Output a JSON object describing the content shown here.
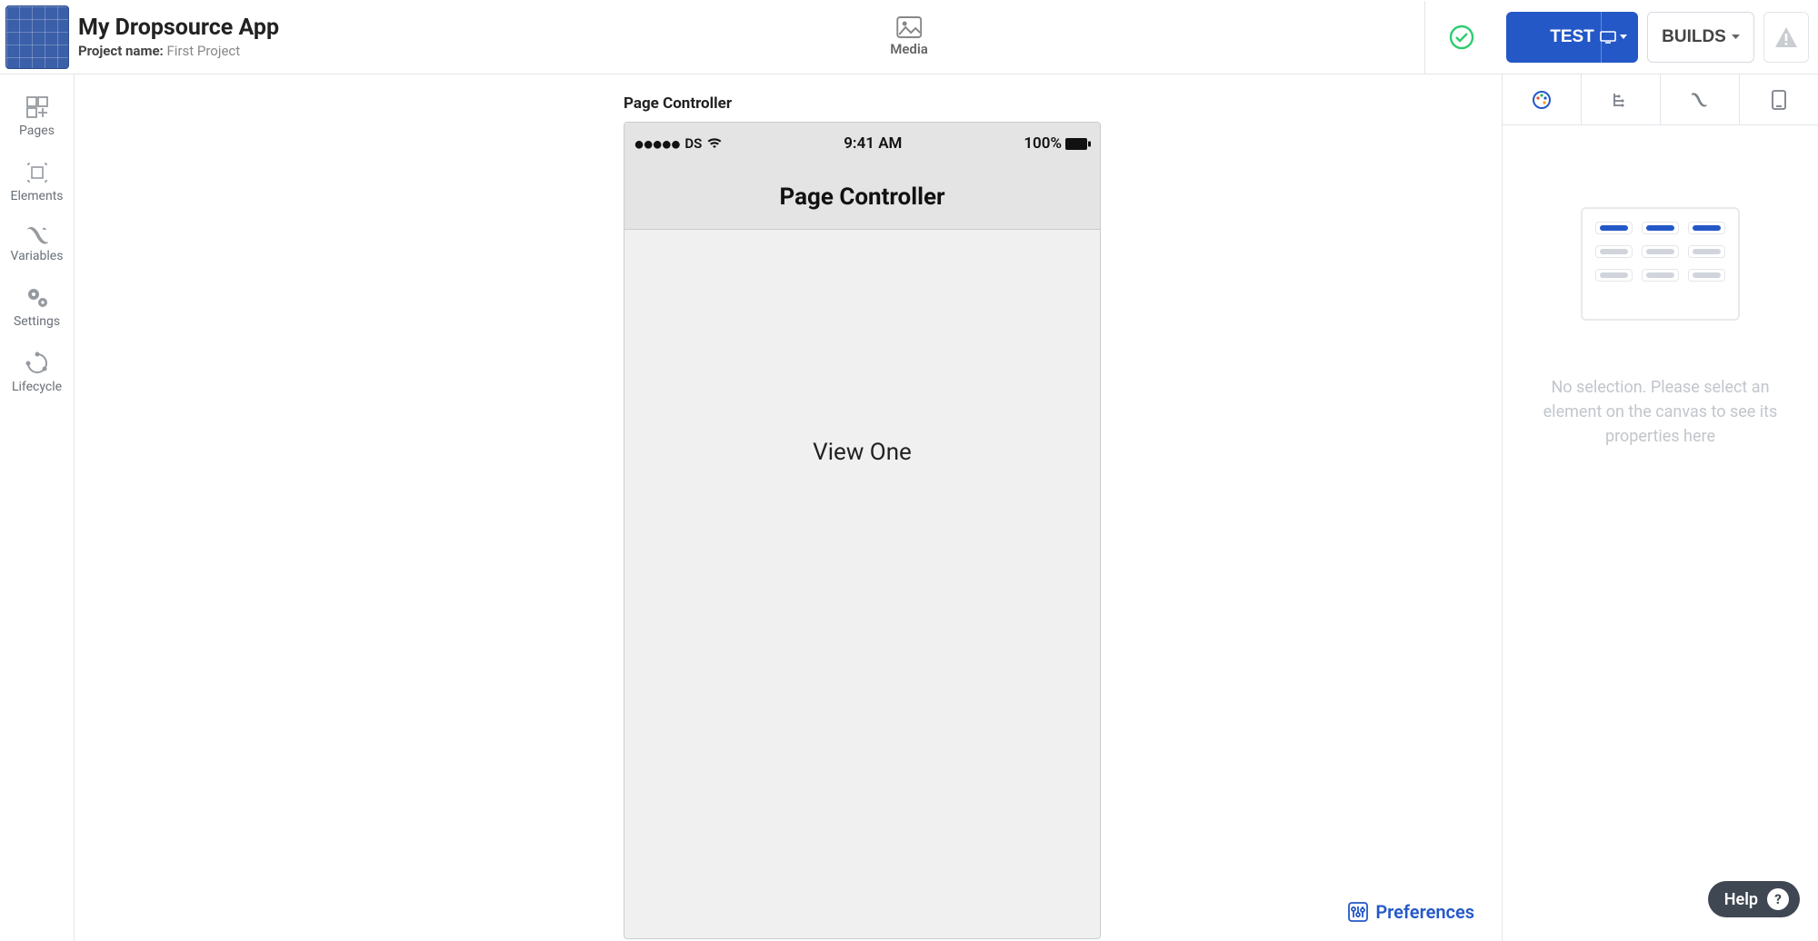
{
  "app": {
    "title": "My Dropsource App",
    "project_label": "Project name:",
    "project_value": "First Project"
  },
  "topbar": {
    "media_label": "Media",
    "test_label": "TEST",
    "builds_label": "BUILDS",
    "icons": {
      "status": "check-circle-icon",
      "warn": "warning-icon"
    }
  },
  "leftbar": {
    "items": [
      {
        "id": "pages",
        "label": "Pages"
      },
      {
        "id": "elements",
        "label": "Elements"
      },
      {
        "id": "variables",
        "label": "Variables"
      },
      {
        "id": "settings",
        "label": "Settings"
      },
      {
        "id": "lifecycle",
        "label": "Lifecycle"
      }
    ]
  },
  "canvas": {
    "page_name": "Page Controller",
    "statusbar": {
      "carrier": "DS",
      "time": "9:41 AM",
      "battery": "100%"
    },
    "navbar_title": "Page Controller",
    "view_text": "View One",
    "preferences_label": "Preferences"
  },
  "rightpanel": {
    "empty_text": "No selection. Please select an element on the canvas to see its properties here",
    "tabs": [
      {
        "id": "styles",
        "icon": "palette-icon"
      },
      {
        "id": "tree",
        "icon": "tree-icon"
      },
      {
        "id": "vars",
        "icon": "x-var-icon"
      },
      {
        "id": "device",
        "icon": "phone-icon"
      }
    ]
  },
  "help": {
    "label": "Help"
  }
}
